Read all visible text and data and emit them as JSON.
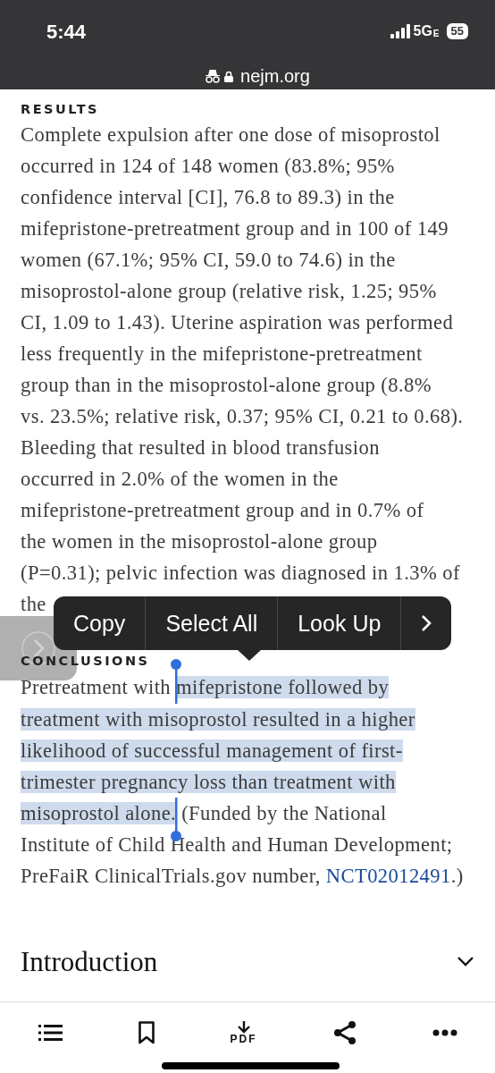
{
  "status_bar": {
    "time": "5:44",
    "network": "5G",
    "network_suffix": "E",
    "battery": "55"
  },
  "address_bar": {
    "domain": "nejm.org",
    "private": true,
    "secure": true
  },
  "sections": [
    {
      "heading": "RESULTS",
      "segments": [
        {
          "text": "Complete expulsion after one dose of misoprostol\noccurred in 124 of 148 women (83.8%; 95%\nconfidence interval [CI], 76.8 to 89.3) in the\nmifepristone-pretreatment group and in 100 of 149\nwomen (67.1%; 95% CI, 59.0 to 74.6) in the\nmisoprostol-alone group (relative risk, 1.25; 95%\nCI, 1.09 to 1.43). Uterine aspiration was performed\nless frequently in the mifepristone-pretreatment\ngroup than in the misoprostol-alone group (8.8%\nvs. 23.5%; relative risk, 0.37; 95% CI, 0.21 to 0.68).\nBleeding that resulted in blood transfusion\noccurred in 2.0% of the women in the\nmifepristone-pretreatment group and in 0.7% of\nthe women in the misoprostol-alone group\n(P=0.31); pelvic infection was diagnosed in 1.3% of\nthe",
          "selected": false
        }
      ]
    },
    {
      "heading": "CONCLUSIONS",
      "segments": [
        {
          "text": "Pretreatment with ",
          "selected": false
        },
        {
          "text": "mifepristone followed by\ntreatment with misoprostol resulted in a higher\nlikelihood of successful management of first-trimester pregnancy loss than treatment with\nmisoprostol alone.",
          "selected": true
        },
        {
          "text": " (Funded by the National\nInstitute of Child Health and Human Development;\nPreFaiR ClinicalTrials.gov number, ",
          "selected": false
        }
      ],
      "link": "NCT02012491",
      "after_link": ".)"
    }
  ],
  "context_menu": {
    "items": [
      "Copy",
      "Select All",
      "Look Up"
    ],
    "has_more": true
  },
  "collapsed_section": {
    "title": "Introduction",
    "expanded": false
  },
  "toolbar": {
    "items": [
      {
        "kind": "list"
      },
      {
        "kind": "bookmark"
      },
      {
        "kind": "pdf",
        "label": "PDF"
      },
      {
        "kind": "share"
      },
      {
        "kind": "more"
      }
    ]
  }
}
